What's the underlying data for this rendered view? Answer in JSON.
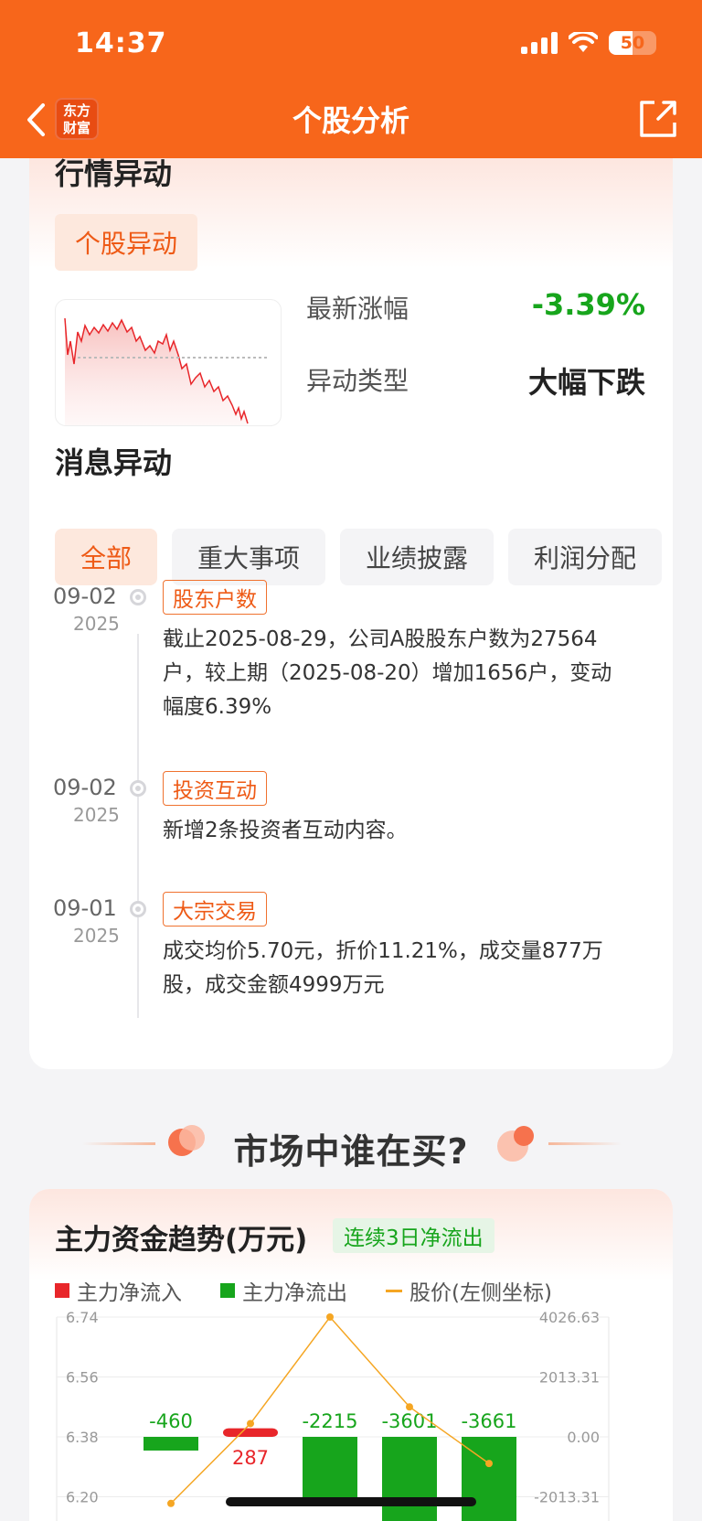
{
  "status_bar": {
    "time": "14:37",
    "battery": "50"
  },
  "nav": {
    "logo_line1": "东方",
    "logo_line2": "财富",
    "title": "个股分析"
  },
  "quote_anomaly": {
    "heading": "行情异动",
    "tab": "个股异动",
    "latest_change_label": "最新涨幅",
    "latest_change_value": "-3.39%",
    "type_label": "异动类型",
    "type_value": "大幅下跌"
  },
  "news_anomaly": {
    "heading": "消息异动",
    "filters": [
      "全部",
      "重大事项",
      "业绩披露",
      "利润分配"
    ],
    "items": [
      {
        "date": "09-02",
        "year": "2025",
        "tag": "股东户数",
        "lines": [
          "截止2025-08-29，公司A股股东户数为27564",
          "户，较上期（2025-08-20）增加1656户，变动",
          "幅度6.39%"
        ]
      },
      {
        "date": "09-02",
        "year": "2025",
        "tag": "投资互动",
        "lines": [
          "新增2条投资者互动内容。"
        ]
      },
      {
        "date": "09-01",
        "year": "2025",
        "tag": "大宗交易",
        "lines": [
          "成交均价5.70元，折价11.21%，成交量877万",
          "股，成交金额4999万元"
        ]
      }
    ]
  },
  "market_section": {
    "title": "市场中谁在买?"
  },
  "fund_trend": {
    "title": "主力资金趋势(万元)",
    "badge": "连续3日净流出",
    "legend": {
      "inflow": "主力净流入",
      "outflow": "主力净流出",
      "price": "股价(左侧坐标)"
    },
    "colors": {
      "inflow": "#e8262a",
      "outflow": "#17a51c",
      "price": "#f5a623"
    }
  },
  "chart_data": {
    "type": "bar",
    "left_axis_ticks": [
      "6.74",
      "6.56",
      "6.38",
      "6.20"
    ],
    "right_axis_ticks": [
      "4026.63",
      "2013.31",
      "0.00",
      "-2013.31"
    ],
    "ylim_left": [
      6.2,
      6.74
    ],
    "ylim_right": [
      -2013.31,
      4026.63
    ],
    "series": [
      {
        "name": "主力净流入/净流出",
        "values": [
          -460,
          287,
          -2215,
          -3601,
          -3661
        ],
        "labels": [
          "-460",
          "287",
          "-2215",
          "-3601",
          "-3661"
        ]
      },
      {
        "name": "股价(左侧坐标)",
        "values": [
          6.18,
          6.42,
          6.74,
          6.47,
          6.3
        ]
      }
    ]
  }
}
